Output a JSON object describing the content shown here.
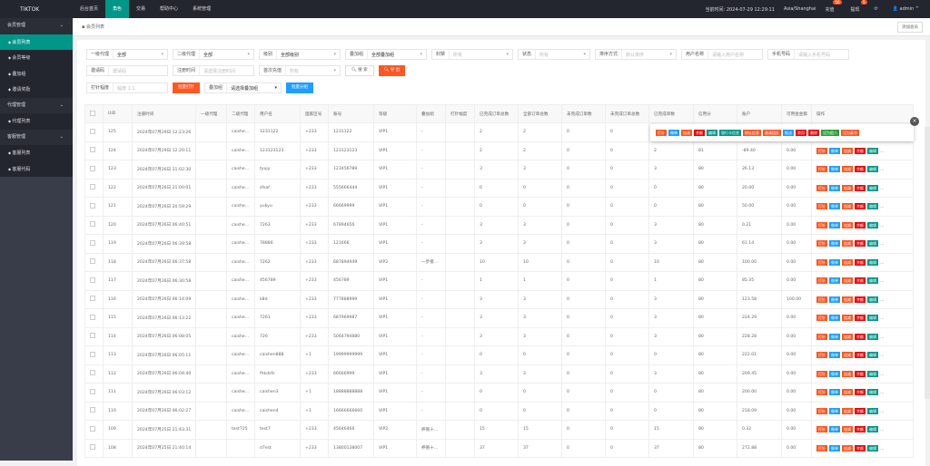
{
  "topbar": {
    "logo": "TIKTOK",
    "nav": [
      "后台首页",
      "角色",
      "交易",
      "帮助中心",
      "系统管理"
    ],
    "active": 1,
    "time": "当前时间: 2024-07-29 12:29:11",
    "tz": "Asia/Shanghai",
    "recharge": "充值",
    "recharge_badge": "56",
    "withdraw": "提现",
    "withdraw_badge": "5",
    "refresh": "⟳",
    "user": "admin"
  },
  "sidebar": [
    {
      "label": "会员管理",
      "type": "group"
    },
    {
      "label": "会员列表",
      "type": "item",
      "sel": true,
      "icon": "user-icon"
    },
    {
      "label": "会员等级",
      "type": "item",
      "icon": "link-icon"
    },
    {
      "label": "叠加组",
      "type": "item",
      "icon": "list-icon"
    },
    {
      "label": "邀请奖励",
      "type": "item",
      "icon": "link-icon"
    },
    {
      "label": "代理管理",
      "type": "group"
    },
    {
      "label": "代理列表",
      "type": "item",
      "icon": "link-icon"
    },
    {
      "label": "客服管理",
      "type": "group"
    },
    {
      "label": "客服列表",
      "type": "item",
      "icon": "users-icon"
    },
    {
      "label": "客服代码",
      "type": "item",
      "icon": "code-icon"
    }
  ],
  "breadcrumb": "会员列表",
  "add_button": "添加会员",
  "filters": {
    "row1": [
      {
        "label": "一级代理",
        "value": "全部",
        "select": true
      },
      {
        "label": "二级代理",
        "value": "全部",
        "select": true
      },
      {
        "label": "级别",
        "value": "全部级别",
        "select": true
      },
      {
        "label": "叠加组",
        "value": "全部叠加组",
        "select": true
      },
      {
        "label": "封禁",
        "placeholder": "所有",
        "select": true
      },
      {
        "label": "状态",
        "placeholder": "所有",
        "select": true
      },
      {
        "label": "排序方式",
        "placeholder": "默认排序",
        "select": true
      },
      {
        "label": "用户名称",
        "placeholder": "请输入用户名称"
      },
      {
        "label": "手机号码",
        "placeholder": "请输入手机号码"
      }
    ],
    "row2": [
      {
        "label": "邀请码",
        "placeholder": "邀请码"
      },
      {
        "label": "注册时间",
        "placeholder": "请选择注册时间"
      },
      {
        "label": "首次充值",
        "placeholder": "所有",
        "select": true
      }
    ],
    "search": "搜 索",
    "export": "导 出",
    "row3": {
      "label": "打针幅度",
      "placeholder": "幅度 1.1",
      "batch_inject": "批量打针",
      "group_label": "叠加组",
      "group_value": "请选择叠加组",
      "batch_group": "批量分组"
    }
  },
  "table": {
    "headers": [
      "UID",
      "注册时间",
      "一级代理",
      "二级代理",
      "用户名",
      "国家区号",
      "账号",
      "等级",
      "叠加组",
      "打针幅度",
      "已完成订单总数",
      "全部订单总数",
      "未完成订单数",
      "未完成订单总数",
      "已完成单数",
      "信用分",
      "账户",
      "可用金金额",
      "操作"
    ],
    "rows": [
      [
        "125",
        "2024年07月29日 12:23:26",
        "",
        "caishe...",
        "1231122",
        "+233",
        "1231122",
        "VIP1",
        "-",
        "",
        "2",
        "2",
        "0",
        "0",
        "",
        "",
        "",
        "",
        ""
      ],
      [
        "124",
        "2024年07月29日 12:20:11",
        "",
        "caishe...",
        "123123123",
        "+233",
        "123123123",
        "VIP1",
        "-",
        "",
        "2",
        "2",
        "0",
        "0",
        "2",
        "81",
        "-89.40",
        "0.00"
      ],
      [
        "123",
        "2024年07月26日 21:02:30",
        "",
        "caishe...",
        "tyujy",
        "+233",
        "123456789",
        "VIP1",
        "-",
        "",
        "3",
        "3",
        "0",
        "0",
        "3",
        "80",
        "26.13",
        "0.00"
      ],
      [
        "122",
        "2024年07月26日 21:00:01",
        "",
        "caishe...",
        "sfsaf",
        "+233",
        "555666444",
        "VIP1",
        "-",
        "",
        "0",
        "0",
        "0",
        "0",
        "0",
        "80",
        "20.00",
        "0.00"
      ],
      [
        "121",
        "2024年07月26日 20:59:29",
        "",
        "caishe...",
        "yukyu",
        "+233",
        "66669999",
        "VIP1",
        "-",
        "",
        "0",
        "0",
        "0",
        "0",
        "0",
        "80",
        "50.00",
        "0.00"
      ],
      [
        "120",
        "2024年07月26日 06:40:51",
        "",
        "caishe...",
        "7263",
        "+233",
        "67894656",
        "VIP1",
        "-",
        "",
        "3",
        "3",
        "0",
        "0",
        "3",
        "80",
        "0.21",
        "0.00"
      ],
      [
        "119",
        "2024年07月26日 06:39:58",
        "",
        "caishe...",
        "78886",
        "+233",
        "121666",
        "VIP1",
        "-",
        "",
        "3",
        "3",
        "0",
        "0",
        "3",
        "80",
        "61.14",
        "0.00"
      ],
      [
        "118",
        "2024年07月26日 06:37:58",
        "",
        "caishe...",
        "7262",
        "+233",
        "687894949",
        "VIP2",
        "一步接...",
        "",
        "10",
        "10",
        "0",
        "0",
        "10",
        "80",
        "100.00",
        "0.00"
      ],
      [
        "117",
        "2024年07月26日 06:30:58",
        "",
        "caishe...",
        "456789",
        "+233",
        "456789",
        "VIP1",
        "-",
        "",
        "1",
        "1",
        "0",
        "0",
        "1",
        "80",
        "85.35",
        "0.00"
      ],
      [
        "116",
        "2024年07月26日 06:14:09",
        "",
        "caishe...",
        "k8d",
        "+233",
        "777888999",
        "VIP1",
        "-",
        "",
        "3",
        "3",
        "0",
        "0",
        "3",
        "80",
        "123.58",
        "100.00"
      ],
      [
        "115",
        "2024年07月26日 06:13:22",
        "",
        "caishe...",
        "7261",
        "+233",
        "687969987",
        "VIP1",
        "-",
        "",
        "3",
        "3",
        "0",
        "0",
        "3",
        "80",
        "224.29",
        "0.00"
      ],
      [
        "114",
        "2024年07月26日 06:08:05",
        "",
        "caishe...",
        "726",
        "+233",
        "5064794880",
        "VIP1",
        "-",
        "",
        "3",
        "3",
        "0",
        "0",
        "3",
        "80",
        "228.28",
        "0.00"
      ],
      [
        "113",
        "2024年07月26日 06:05:11",
        "",
        "caishe...",
        "caishen888",
        "+1",
        "19999999999",
        "VIP1",
        "-",
        "",
        "0",
        "0",
        "0",
        "0",
        "0",
        "80",
        "222.01",
        "0.00"
      ],
      [
        "112",
        "2024年07月26日 06:04:40",
        "",
        "caishe...",
        "fhkdsfs",
        "+233",
        "66666999",
        "VIP1",
        "-",
        "",
        "3",
        "3",
        "0",
        "0",
        "3",
        "80",
        "209.45",
        "0.00"
      ],
      [
        "111",
        "2024年07月26日 06:03:12",
        "",
        "caishe...",
        "caishen3",
        "+1",
        "18888888888",
        "VIP1",
        "-",
        "",
        "0",
        "0",
        "0",
        "0",
        "0",
        "80",
        "200.00",
        "0.00"
      ],
      [
        "110",
        "2024年07月26日 06:02:27",
        "",
        "caishe...",
        "caishen4",
        "+1",
        "16666666660",
        "VIP1",
        "-",
        "",
        "0",
        "0",
        "0",
        "0",
        "0",
        "80",
        "218.09",
        "0.00"
      ],
      [
        "109",
        "2024年07月25日 21:43:31",
        "",
        "test725",
        "test7",
        "+233",
        "45646466",
        "VIP2",
        "养殖十...",
        "",
        "15",
        "15",
        "0",
        "0",
        "15",
        "80",
        "0.32",
        "0.00"
      ],
      [
        "108",
        "2024年07月25日 21:40:14",
        "",
        "",
        "d7est",
        "+233",
        "13800138007",
        "VIP1",
        "养殖十...",
        "",
        "37",
        "37",
        "0",
        "0",
        "37",
        "80",
        "272.88",
        "0.00"
      ]
    ],
    "row_actions": [
      {
        "label": "打针",
        "color": "o"
      },
      {
        "label": "做单",
        "color": "b"
      },
      {
        "label": "加减",
        "color": "o"
      },
      {
        "label": "余额",
        "color": "r"
      },
      {
        "label": "编辑",
        "color": "t"
      }
    ],
    "more": "...",
    "popup_actions": [
      {
        "label": "打针",
        "color": "o"
      },
      {
        "label": "做单",
        "color": "b"
      },
      {
        "label": "加减",
        "color": "o"
      },
      {
        "label": "余额",
        "color": "r"
      },
      {
        "label": "编辑",
        "color": "t"
      },
      {
        "label": "银行卡信息",
        "color": "t"
      },
      {
        "label": "地址信息",
        "color": "o"
      },
      {
        "label": "邀请团队",
        "color": "o"
      },
      {
        "label": "推送",
        "color": "b"
      },
      {
        "label": "禁用",
        "color": "r"
      },
      {
        "label": "删除",
        "color": "r"
      },
      {
        "label": "设为假人",
        "color": "g"
      },
      {
        "label": "设为真号",
        "color": "o"
      }
    ],
    "popup_close": "×"
  }
}
